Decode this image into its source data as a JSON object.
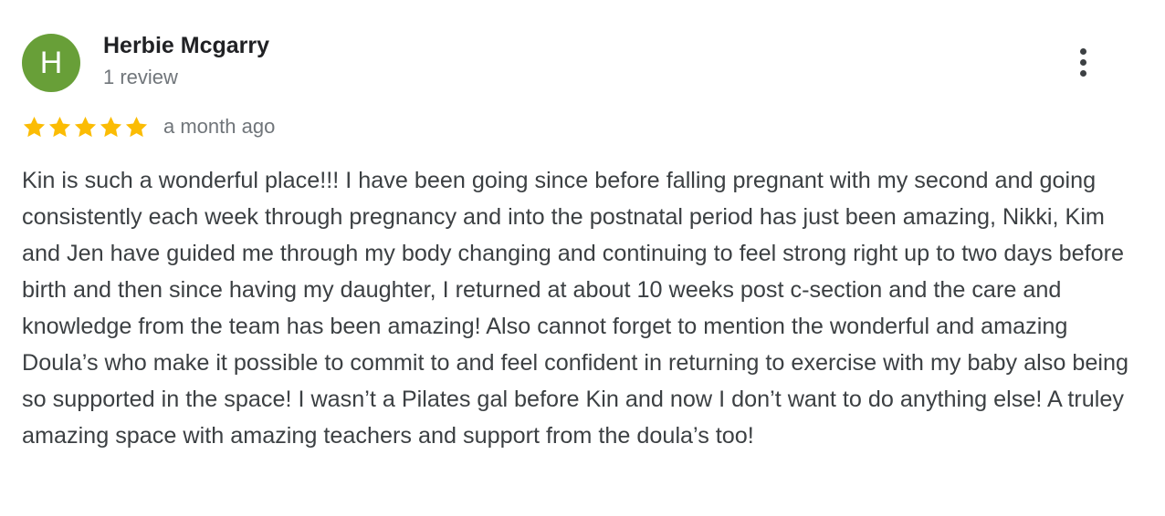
{
  "reviewer": {
    "initial": "H",
    "name": "Herbie Mcgarry",
    "review_count": "1 review",
    "avatar_color": "#689f38"
  },
  "rating": {
    "stars": 5,
    "max_stars": 5,
    "star_color": "#fbbc04",
    "date": "a month ago"
  },
  "more_options_icon": "more-vert-icon",
  "review": {
    "text": "Kin is such a wonderful place!!! I have been going since before falling pregnant with my second and going consistently each week through pregnancy and into the postnatal period has just been amazing, Nikki, Kim and Jen have guided me through my body changing and continuing to feel strong right up to two days before birth and then since having my daughter, I returned at about 10 weeks post c-section and the care and knowledge from the team has been amazing! Also cannot forget to mention the wonderful and amazing Doula’s who make it possible to commit to and feel confident in returning to exercise with my baby also being so supported in the space! I wasn’t a Pilates gal before Kin and now I don’t want to do anything else! A truley amazing space with amazing teachers and support from the doula’s too!"
  }
}
